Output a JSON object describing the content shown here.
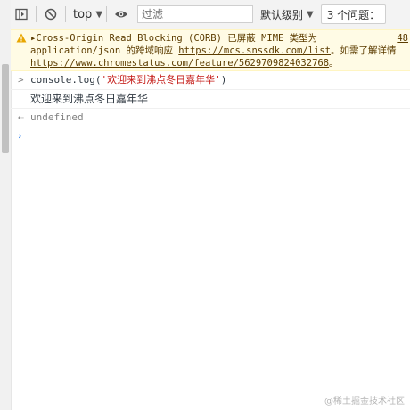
{
  "toolbar": {
    "context_label": "top",
    "filter_placeholder": "过滤",
    "filter_value": "",
    "levels_label": "默认级别",
    "issues_label": "3 个问题："
  },
  "console": {
    "warning": {
      "prefix": "▸Cross-Origin Read Blocking (CORB) 已屏蔽 MIME 类型为",
      "line2_text": "application/json 的跨域响应 ",
      "line2_link": "https://mcs.snssdk.com/list",
      "line2_suffix": "。如需了解详情",
      "line3_link": "https://www.chromestatus.com/feature/5629709824032768",
      "line3_suffix": "。",
      "source_ref": "48"
    },
    "command_prefix": "console.log(",
    "command_string": "'欢迎来到沸点冬日嘉年华'",
    "command_suffix": ")",
    "log_output": "欢迎来到沸点冬日嘉年华",
    "return_value": "undefined"
  },
  "watermark": "@稀土掘金技术社区",
  "colors": {
    "warning_bg": "#fffbe5",
    "warning_text": "#5c3c00",
    "string": "#c41a16",
    "prompt": "#1a73e8"
  }
}
